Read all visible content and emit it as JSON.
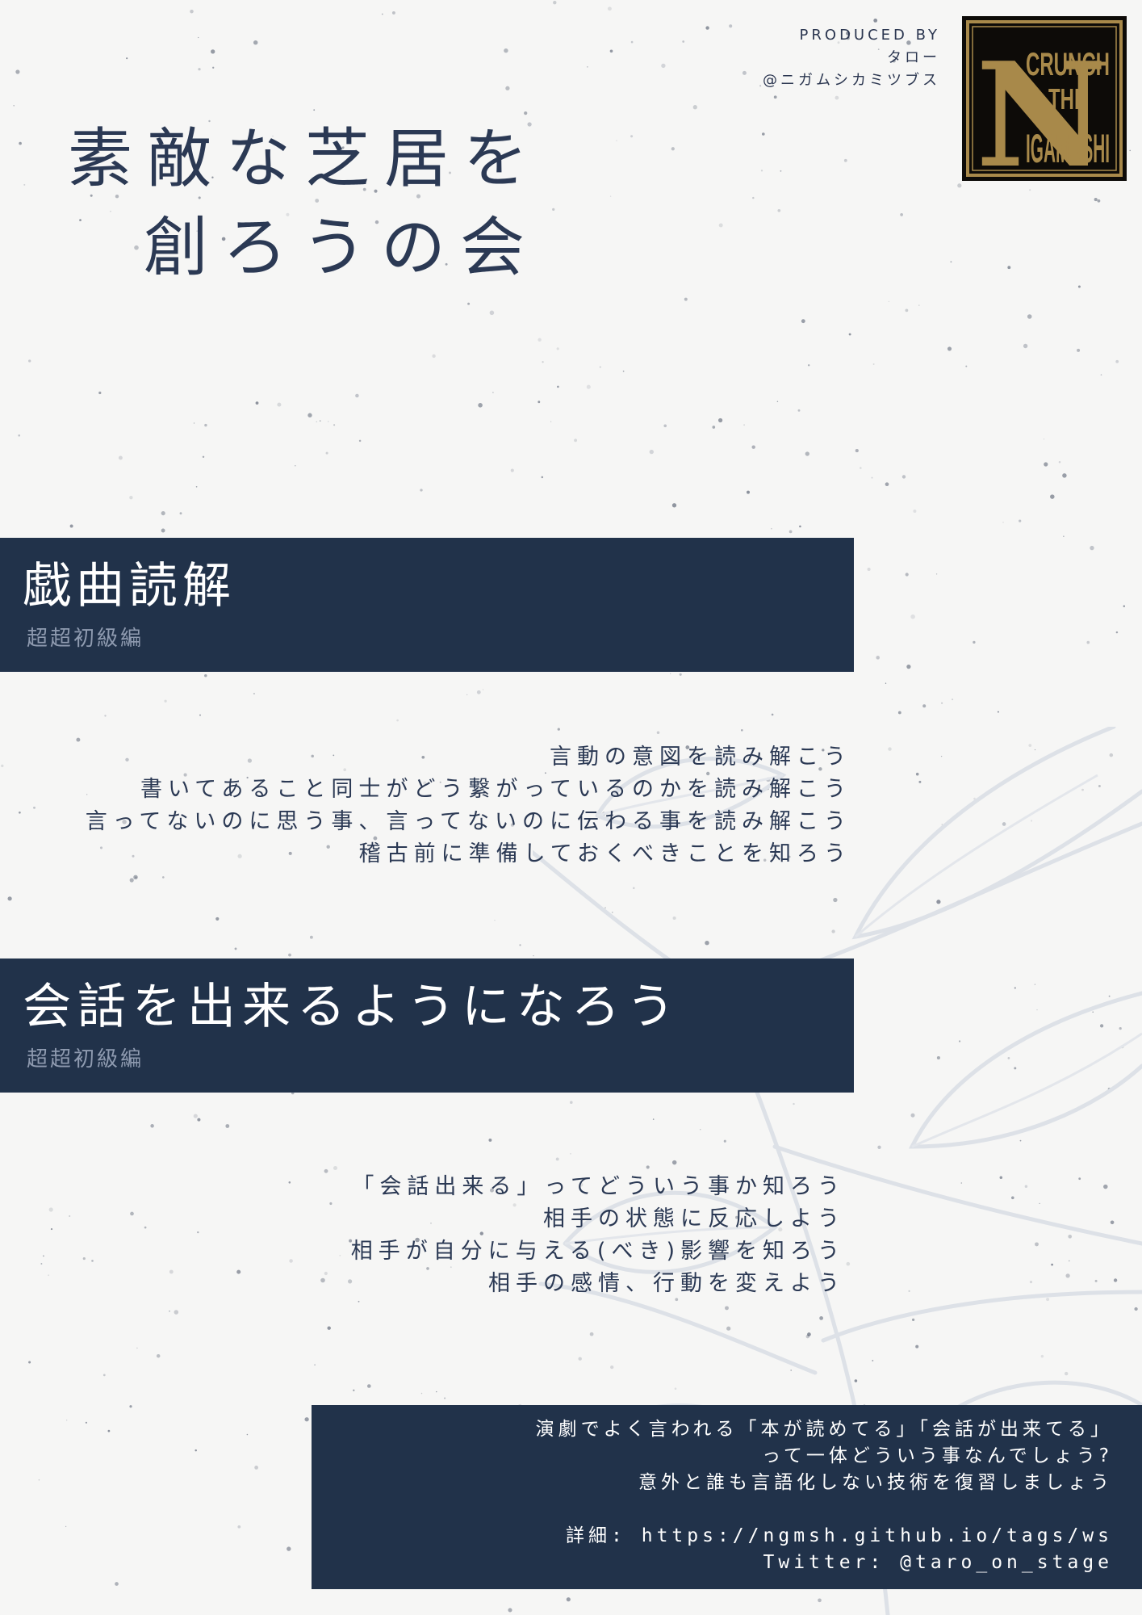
{
  "producer": {
    "label": "PRODUCED BY",
    "name": "タロー",
    "handle": "@ニガムシカミツブス"
  },
  "logo": {
    "icon": "crunch-the-nigamushi-logo-icon",
    "letter": "N",
    "word1": "CRUNCH",
    "word2": "THE",
    "word3": "IGAMUSHI",
    "colors": {
      "gold": "#a8894a",
      "background": "#0d0b08"
    }
  },
  "title": {
    "line1": "素敵な芝居を",
    "line2": "創ろうの会"
  },
  "sections": [
    {
      "heading": "戯曲読解",
      "subheading": "超超初級編",
      "items": [
        "言動の意図を読み解こう",
        "書いてあること同士がどう繋がっているのかを読み解こう",
        "言ってないのに思う事、言ってないのに伝わる事を読み解こう",
        "稽古前に準備しておくべきことを知ろう"
      ]
    },
    {
      "heading": "会話を出来るようになろう",
      "subheading": "超超初級編",
      "items": [
        "「会話出来る」ってどういう事か知ろう",
        "相手の状態に反応しよう",
        "相手が自分に与える(べき)影響を知ろう",
        "相手の感情、行動を変えよう"
      ]
    }
  ],
  "info": {
    "line1": "演劇でよく言われる「本が読めてる」「会話が出来てる」",
    "line2": "って一体どういう事なんでしょう?",
    "line3": "意外と誰も言語化しない技術を復習しましょう",
    "details": "詳細: https://ngmsh.github.io/tags/ws",
    "twitter": "Twitter: @taro_on_stage"
  },
  "colors": {
    "navy": "#21324a",
    "paper": "#f6f6f5",
    "subtext": "#8f9bb0"
  }
}
